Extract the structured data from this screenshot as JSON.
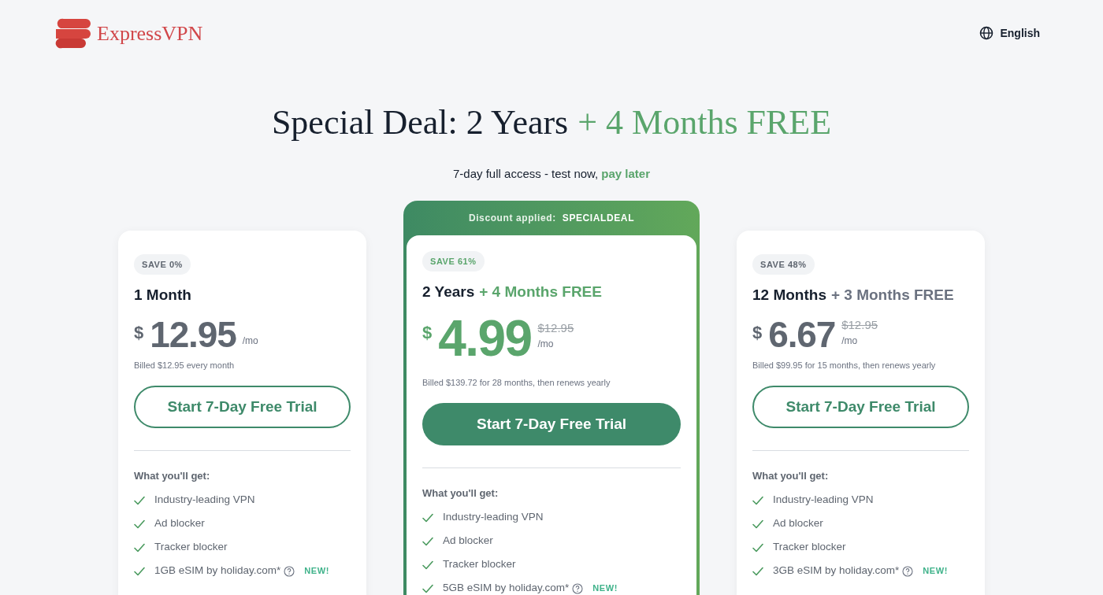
{
  "header": {
    "brand": "ExpressVPN",
    "language": "English"
  },
  "hero": {
    "title": "Special Deal: 2 Years",
    "title_accent": "+ 4 Months FREE",
    "subtitle": "7-day full access - test now,",
    "subtitle_accent": "pay later"
  },
  "plans": [
    {
      "highlighted": false,
      "save": "SAVE 0%",
      "name": "1 Month",
      "currency": "$",
      "price": "12.95",
      "per": "/mo",
      "billed": "Billed $12.95 every month",
      "cta": "Start 7-Day Free Trial",
      "features_title": "What you'll get:",
      "features": [
        {
          "kind": "plain",
          "text": "Industry-leading VPN"
        },
        {
          "kind": "plain",
          "text": "Ad blocker"
        },
        {
          "kind": "plain",
          "text": "Tracker blocker"
        },
        {
          "kind": "esim",
          "text": "1GB eSIM by holiday.com*",
          "badge": "NEW!"
        }
      ]
    },
    {
      "highlighted": true,
      "banner": "Discount applied:",
      "banner_code": "SPECIALDEAL",
      "save": "SAVE 61%",
      "name": "2 Years",
      "name_extra": "+ 4 Months FREE",
      "currency": "$",
      "price": "4.99",
      "old_price": "$12.95",
      "per": "/mo",
      "billed": "Billed $139.72 for 28 months, then renews yearly",
      "cta": "Start 7-Day Free Trial",
      "features_title": "What you'll get:",
      "features": [
        {
          "kind": "plain",
          "text": "Industry-leading VPN"
        },
        {
          "kind": "plain",
          "text": "Ad blocker"
        },
        {
          "kind": "plain",
          "text": "Tracker blocker"
        },
        {
          "kind": "esim",
          "text": "5GB eSIM by holiday.com*",
          "badge": "NEW!"
        }
      ]
    },
    {
      "highlighted": false,
      "save": "SAVE 48%",
      "name": "12 Months",
      "name_extra": "+ 3 Months FREE",
      "currency": "$",
      "price": "6.67",
      "old_price": "$12.95",
      "per": "/mo",
      "billed": "Billed $99.95 for 15 months, then renews yearly",
      "cta": "Start 7-Day Free Trial",
      "features_title": "What you'll get:",
      "features": [
        {
          "kind": "plain",
          "text": "Industry-leading VPN"
        },
        {
          "kind": "plain",
          "text": "Ad blocker"
        },
        {
          "kind": "plain",
          "text": "Tracker blocker"
        },
        {
          "kind": "esim",
          "text": "3GB eSIM by holiday.com*",
          "badge": "NEW!"
        }
      ]
    }
  ]
}
